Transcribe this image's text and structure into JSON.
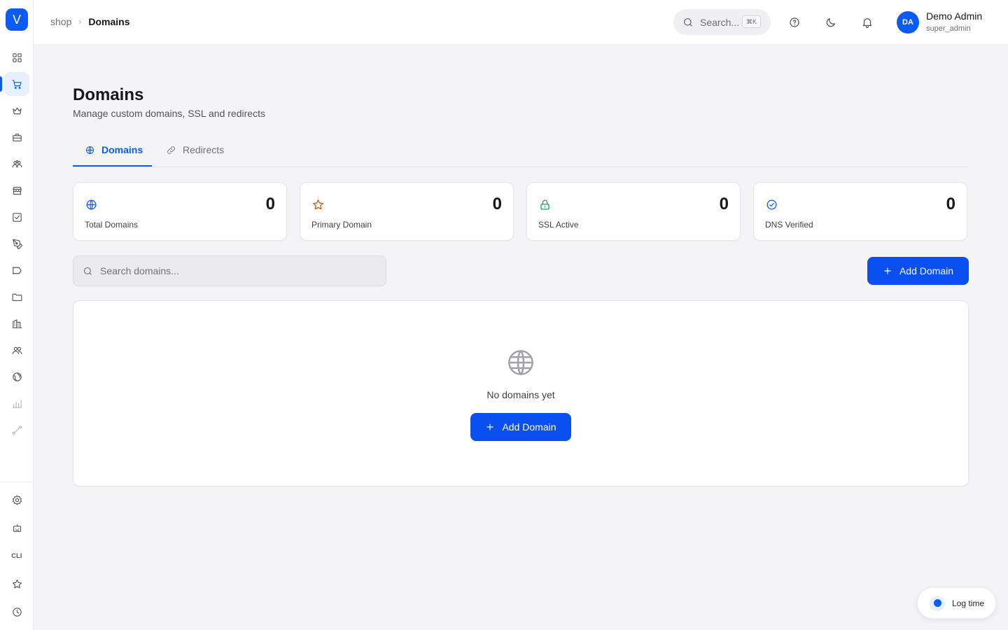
{
  "app": {
    "logo_letter": "V",
    "brand_color": "#0a5cf5"
  },
  "sidebar": {
    "items": [
      {
        "icon": "dashboard-icon"
      },
      {
        "icon": "cart-icon",
        "active": true
      },
      {
        "icon": "crown-icon"
      },
      {
        "icon": "briefcase-icon"
      },
      {
        "icon": "users-group-icon"
      },
      {
        "icon": "store-icon"
      },
      {
        "icon": "checkbox-icon"
      },
      {
        "icon": "pen-tool-icon"
      },
      {
        "icon": "megaphone-icon"
      },
      {
        "icon": "folder-icon"
      },
      {
        "icon": "building-icon"
      },
      {
        "icon": "team-icon"
      },
      {
        "icon": "globe-icon"
      },
      {
        "icon": "bar-chart-icon"
      },
      {
        "icon": "route-icon"
      }
    ],
    "bottom": [
      {
        "icon": "settings-icon"
      },
      {
        "icon": "robot-icon"
      },
      {
        "icon": "cli-icon",
        "label": "CLI"
      },
      {
        "icon": "star-icon"
      },
      {
        "icon": "clock-icon"
      }
    ]
  },
  "header": {
    "breadcrumb": {
      "root": "shop",
      "current": "Domains"
    },
    "search": {
      "placeholder": "Search...",
      "shortcut": "⌘K"
    },
    "user": {
      "initials": "DA",
      "name": "Demo Admin",
      "role": "super_admin"
    }
  },
  "page": {
    "title": "Domains",
    "subtitle": "Manage custom domains, SSL and redirects",
    "tabs": [
      {
        "label": "Domains",
        "icon": "globe-icon",
        "active": true
      },
      {
        "label": "Redirects",
        "icon": "link-icon",
        "active": false
      }
    ],
    "stats": [
      {
        "label": "Total Domains",
        "value": "0",
        "icon": "globe-icon",
        "color": "#0a5cf5"
      },
      {
        "label": "Primary Domain",
        "value": "0",
        "icon": "star-icon",
        "color": "#c2570c"
      },
      {
        "label": "SSL Active",
        "value": "0",
        "icon": "lock-icon",
        "color": "#16a34a"
      },
      {
        "label": "DNS Verified",
        "value": "0",
        "icon": "check-circle-icon",
        "color": "#0a5cf5"
      }
    ],
    "search_placeholder": "Search domains...",
    "add_button_label": "Add Domain",
    "empty_state": {
      "message": "No domains yet",
      "button_label": "Add Domain"
    }
  },
  "log_time": {
    "label": "Log time"
  }
}
